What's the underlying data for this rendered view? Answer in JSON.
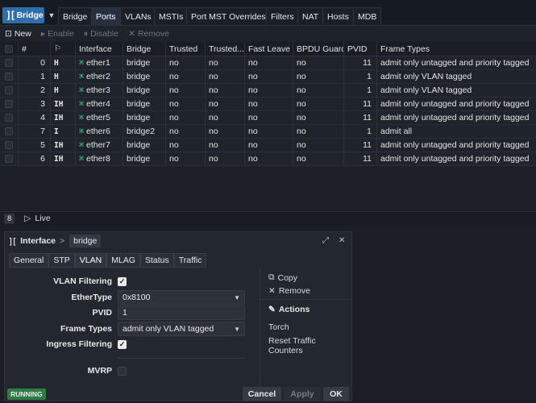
{
  "topnav": {
    "logo_label": "Bridge",
    "tabs": [
      "Bridge",
      "Ports",
      "VLANs",
      "MSTIs",
      "Port MST Overrides",
      "Filters",
      "NAT",
      "Hosts",
      "MDB"
    ],
    "active_tab": "Ports"
  },
  "toolbar": {
    "new": "New",
    "enable": "Enable",
    "disable": "Disable",
    "remove": "Remove"
  },
  "table": {
    "columns": [
      "#",
      "",
      "Interface",
      "Bridge",
      "Trusted",
      "Trusted...",
      "Fast Leave",
      "BPDU Guard",
      "PVID",
      "Frame Types"
    ],
    "rows": [
      {
        "num": "0",
        "flags": "H",
        "interface": "ether1",
        "bridge": "bridge",
        "trusted": "no",
        "trusted2": "no",
        "fast_leave": "no",
        "bpdu_guard": "no",
        "pvid": "11",
        "frame_types": "admit only untagged and priority tagged"
      },
      {
        "num": "1",
        "flags": "H",
        "interface": "ether2",
        "bridge": "bridge",
        "trusted": "no",
        "trusted2": "no",
        "fast_leave": "no",
        "bpdu_guard": "no",
        "pvid": "1",
        "frame_types": "admit only VLAN tagged"
      },
      {
        "num": "2",
        "flags": "H",
        "interface": "ether3",
        "bridge": "bridge",
        "trusted": "no",
        "trusted2": "no",
        "fast_leave": "no",
        "bpdu_guard": "no",
        "pvid": "1",
        "frame_types": "admit only VLAN tagged"
      },
      {
        "num": "3",
        "flags": "IH",
        "interface": "ether4",
        "bridge": "bridge",
        "trusted": "no",
        "trusted2": "no",
        "fast_leave": "no",
        "bpdu_guard": "no",
        "pvid": "11",
        "frame_types": "admit only untagged and priority tagged"
      },
      {
        "num": "4",
        "flags": "IH",
        "interface": "ether5",
        "bridge": "bridge",
        "trusted": "no",
        "trusted2": "no",
        "fast_leave": "no",
        "bpdu_guard": "no",
        "pvid": "11",
        "frame_types": "admit only untagged and priority tagged"
      },
      {
        "num": "7",
        "flags": "I",
        "interface": "ether6",
        "bridge": "bridge2",
        "trusted": "no",
        "trusted2": "no",
        "fast_leave": "no",
        "bpdu_guard": "no",
        "pvid": "1",
        "frame_types": "admit all"
      },
      {
        "num": "5",
        "flags": "IH",
        "interface": "ether7",
        "bridge": "bridge",
        "trusted": "no",
        "trusted2": "no",
        "fast_leave": "no",
        "bpdu_guard": "no",
        "pvid": "11",
        "frame_types": "admit only untagged and priority tagged"
      },
      {
        "num": "6",
        "flags": "IH",
        "interface": "ether8",
        "bridge": "bridge",
        "trusted": "no",
        "trusted2": "no",
        "fast_leave": "no",
        "bpdu_guard": "no",
        "pvid": "11",
        "frame_types": "admit only untagged and priority tagged"
      }
    ]
  },
  "statusbar": {
    "count": "8",
    "live": "Live"
  },
  "dialog": {
    "title": "Interface",
    "separator": ">",
    "item": "bridge",
    "tabs": [
      "General",
      "STP",
      "VLAN",
      "MLAG",
      "Status",
      "Traffic"
    ],
    "active_tab": "VLAN",
    "form": {
      "vlan_filtering_label": "VLAN Filtering",
      "ethertype_label": "EtherType",
      "ethertype_value": "0x8100",
      "pvid_label": "PVID",
      "pvid_value": "1",
      "frame_types_label": "Frame Types",
      "frame_types_value": "admit only VLAN tagged",
      "ingress_filtering_label": "Ingress Filtering",
      "mvrp_label": "MVRP"
    },
    "side": {
      "copy": "Copy",
      "remove": "Remove",
      "actions": "Actions",
      "torch": "Torch",
      "reset": "Reset Traffic Counters"
    },
    "footer": {
      "status": "RUNNING",
      "cancel": "Cancel",
      "apply": "Apply",
      "ok": "OK"
    }
  }
}
